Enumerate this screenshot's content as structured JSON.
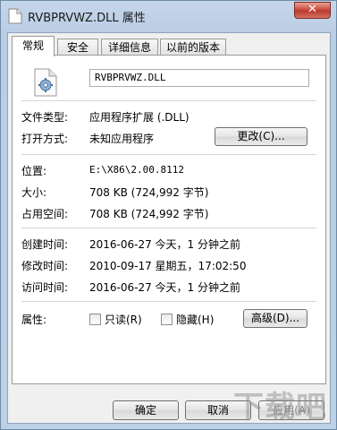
{
  "window": {
    "title": "RVBPRVWZ.DLL 属性",
    "close_label": "✕"
  },
  "tabs": [
    {
      "label": "常规",
      "active": true
    },
    {
      "label": "安全",
      "active": false
    },
    {
      "label": "详细信息",
      "active": false
    },
    {
      "label": "以前的版本",
      "active": false
    }
  ],
  "general": {
    "file_name": "RVBPRVWZ.DLL",
    "file_type_label": "文件类型:",
    "file_type_value": "应用程序扩展 (.DLL)",
    "open_with_label": "打开方式:",
    "open_with_value": "未知应用程序",
    "change_button": "更改(C)...",
    "location_label": "位置:",
    "location_value": "E:\\X86\\2.00.8112",
    "size_label": "大小:",
    "size_value": "708 KB (724,992 字节)",
    "size_on_disk_label": "占用空间:",
    "size_on_disk_value": "708 KB (724,992 字节)",
    "created_label": "创建时间:",
    "created_value": "2016-06-27 今天，1 分钟之前",
    "modified_label": "修改时间:",
    "modified_value": "2010-09-17 星期五，17:02:50",
    "accessed_label": "访问时间:",
    "accessed_value": "2016-06-27 今天，1 分钟之前",
    "attributes_label": "属性:",
    "readonly_label": "只读(R)",
    "hidden_label": "隐藏(H)",
    "advanced_button": "高级(D)..."
  },
  "footer": {
    "ok": "确定",
    "cancel": "取消",
    "apply": "应用(A)"
  },
  "watermark": "下载吧"
}
